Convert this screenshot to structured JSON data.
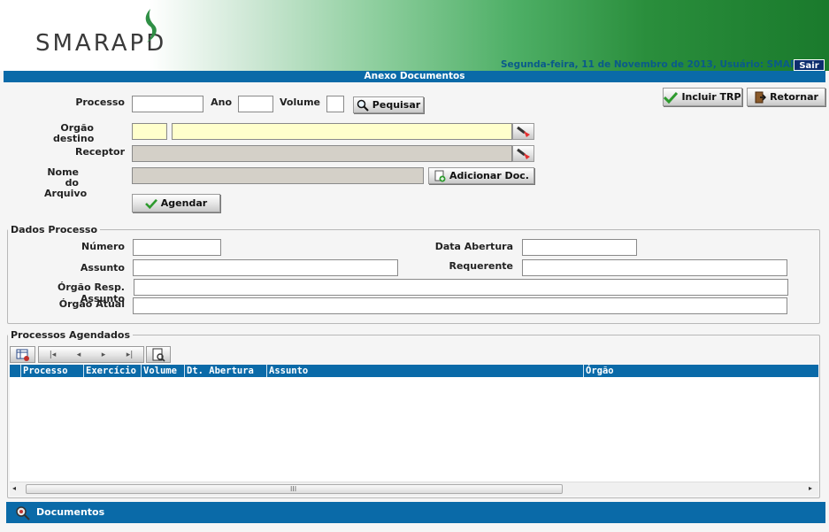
{
  "header": {
    "logo": "SMARAPD",
    "date_user": "Segunda-feira, 11 de Novembro de 2013, Usuário: SMAR",
    "sair": "Sair"
  },
  "title": "Anexo Documentos",
  "form": {
    "processo_label": "Processo",
    "ano_label": "Ano",
    "volume_label": "Volume",
    "pesquisar": "Pequisar",
    "orgao_destino_label_1": "Orgão",
    "orgao_destino_label_2": "destino",
    "receptor_label": "Receptor",
    "nome_label_1": "Nome",
    "nome_label_2": "do",
    "nome_label_3": "Arquivo",
    "adicionar_doc": "Adicionar Doc.",
    "agendar": "Agendar"
  },
  "actions": {
    "incluir_trp": "Incluir TRP",
    "retornar": "Retornar"
  },
  "dados_processo": {
    "legend": "Dados Processo",
    "numero_label": "Número",
    "data_abertura_label": "Data Abertura",
    "assunto_label": "Assunto",
    "requerente_label": "Requerente",
    "orgao_resp_label": "Órgão Resp. Assunto",
    "orgao_atual_label": "Órgão Atual"
  },
  "processos_agendados": {
    "legend": "Processos Agendados",
    "columns": [
      "Processo",
      "Exercício",
      "Volume",
      "Dt. Abertura",
      "Assunto",
      "Órgão"
    ],
    "rows": []
  },
  "documentos": {
    "label": "Documentos"
  },
  "colors": {
    "accent_blue": "#0a6aa8",
    "brand_green": "#1a7a2c",
    "input_yellow": "#ffffcc"
  }
}
